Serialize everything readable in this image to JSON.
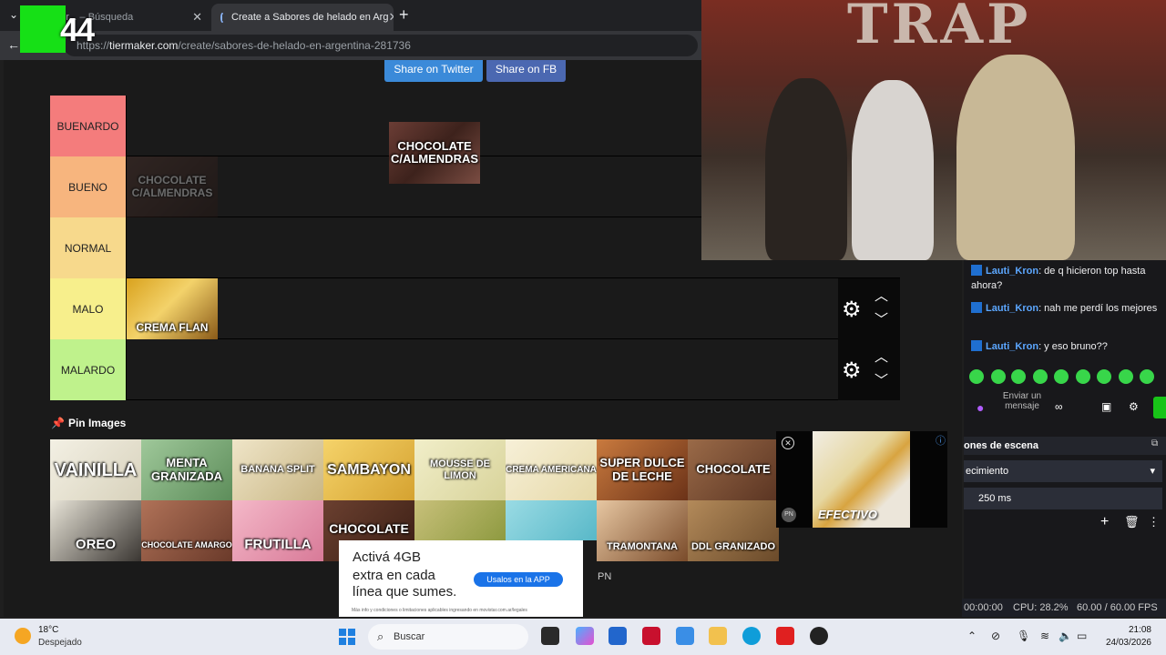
{
  "browser": {
    "tabs": [
      {
        "label": "Sabores de helado prefieres - Búsqueda",
        "display": "e prefer... – Búsqueda"
      },
      {
        "label": "Create a Sabores de helado en Argentina",
        "display": "Create a Sabores de helado en Arg"
      }
    ],
    "url_prefix": "https://",
    "url_host": "tiermaker.com",
    "url_path": "/create/sabores-de-helado-en-argentina-281736",
    "overlay_logo": "44"
  },
  "share": {
    "twitter": "Share on Twitter",
    "facebook": "Share on FB"
  },
  "tiers": [
    {
      "label": "BUENARDO",
      "color": "#f47c7c"
    },
    {
      "label": "BUENO",
      "color": "#f7b57e"
    },
    {
      "label": "NORMAL",
      "color": "#f7d98c"
    },
    {
      "label": "MALO",
      "color": "#f7ef8c"
    },
    {
      "label": "MALARDO",
      "color": "#bff28c"
    }
  ],
  "placed": {
    "dragging": "CHOCOLATE C/ALMENDRAS",
    "bueno_ghost": "CHOCOLATE C/ALMENDRAS",
    "malo": "CREMA FLAN"
  },
  "pin_label": "Pin Images",
  "pool_row1": [
    "VAINILLA",
    "MENTA GRANIZADA",
    "BANANA SPLIT",
    "SAMBAYON",
    "MOUSSE DE LIMON",
    "CREMA AMERICANA",
    "SUPER DULCE DE LECHE",
    "CHOCOLATE"
  ],
  "pool_row2": [
    "OREO",
    "CHOCOLATE AMARGO",
    "FRUTILLA",
    "CHOCOLATE",
    "",
    "",
    "TRAMONTANA",
    "DDL GRANIZADO"
  ],
  "ad": {
    "line1": "Activá 4GB",
    "line2": "extra en cada",
    "line3": "línea que sumes.",
    "button": "Usalos en la APP",
    "legal": "Más info y condiciones o limitaciones aplicables ingresando en movistar.com.ar/legales"
  },
  "ad_corner": "PN",
  "video": {
    "caption": "EFECTIVO",
    "badge": "PN"
  },
  "webcam": {
    "wall_text": "TRAP"
  },
  "chat": [
    {
      "user": "Lauti_Kron",
      "text": ": de q hicieron top hasta ahora?"
    },
    {
      "user": "Lauti_Kron",
      "text": ": nah me perdí los mejores"
    },
    {
      "user": "Lauti_Kron",
      "text": ": y eso bruno??"
    }
  ],
  "chat_input": "Enviar un mensaje",
  "obs": {
    "panel_title": "ones de escena",
    "transition": "ecimiento",
    "duration": "250 ms",
    "time": "00:00:00",
    "cpu": "CPU: 28.2%",
    "fps": "60.00 / 60.00 FPS"
  },
  "taskbar": {
    "temp": "18°C",
    "weather": "Despejado",
    "search": "Buscar",
    "time": "21:08",
    "date": "24/03/2026"
  },
  "colors": {
    "twitter": "#3b8ad9",
    "facebook": "#4b68b1",
    "obs_green": "#38d64a"
  }
}
